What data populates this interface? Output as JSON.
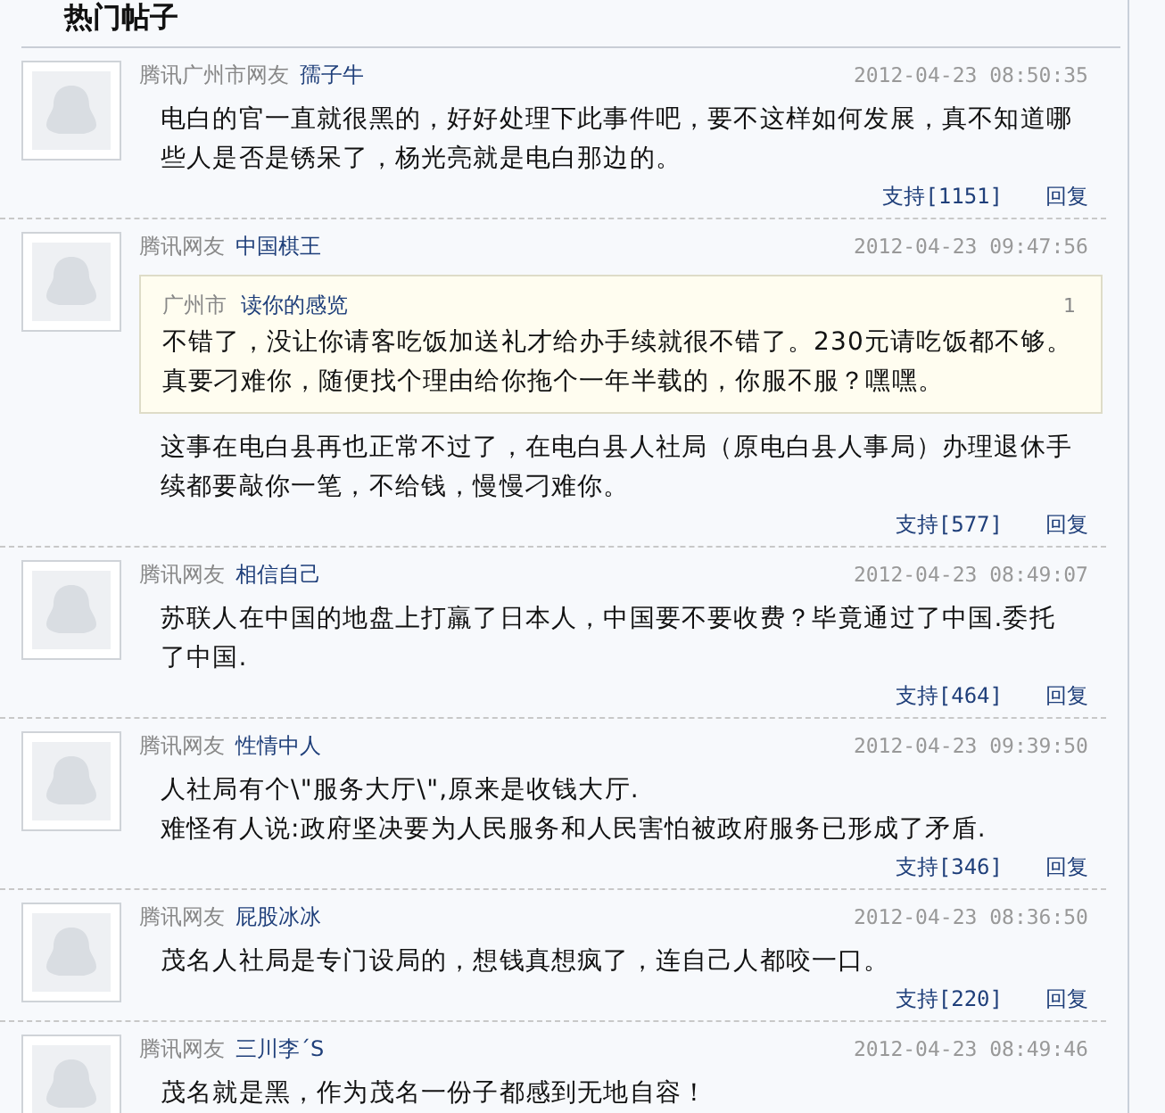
{
  "section_title": "热门帖子",
  "posts": [
    {
      "source": "腾讯广州市网友",
      "user": "孺子牛",
      "time": "2012-04-23 08:50:35",
      "text": "电白的官一直就很黑的，好好处理下此事件吧，要不这样如何发展，真不知道哪些人是否是锈呆了，杨光亮就是电白那边的。",
      "support": "支持[1151]",
      "reply": "回复"
    },
    {
      "source": "腾讯网友",
      "user": "中国棋王",
      "time": "2012-04-23 09:47:56",
      "quote": {
        "source": "广州市",
        "user": "读你的感览",
        "floor": "1",
        "text": "不错了，没让你请客吃饭加送礼才给办手续就很不错了。230元请吃饭都不够。真要刁难你，随便找个理由给你拖个一年半载的，你服不服？嘿嘿。"
      },
      "text": "这事在电白县再也正常不过了，在电白县人社局（原电白县人事局）办理退休手续都要敲你一笔，不给钱，慢慢刁难你。",
      "support": "支持[577]",
      "reply": "回复"
    },
    {
      "source": "腾讯网友",
      "user": "相信自己",
      "time": "2012-04-23 08:49:07",
      "text": "苏联人在中国的地盘上打羸了日本人，中国要不要收费？毕竟通过了中国.委托了中国.",
      "support": "支持[464]",
      "reply": "回复"
    },
    {
      "source": "腾讯网友",
      "user": "性情中人",
      "time": "2012-04-23 09:39:50",
      "text": "人社局有个\\\"服务大厅\\\",原来是收钱大厅.\n难怪有人说:政府坚决要为人民服务和人民害怕被政府服务已形成了矛盾.",
      "support": "支持[346]",
      "reply": "回复"
    },
    {
      "source": "腾讯网友",
      "user": "屁股冰冰",
      "time": "2012-04-23 08:36:50",
      "text": "茂名人社局是专门设局的，想钱真想疯了，连自己人都咬一口。",
      "support": "支持[220]",
      "reply": "回复"
    },
    {
      "source": "腾讯网友",
      "user": "三川李ˊS",
      "time": "2012-04-23 08:49:46",
      "text": "茂名就是黑，作为茂名一份子都感到无地自容！"
    }
  ]
}
